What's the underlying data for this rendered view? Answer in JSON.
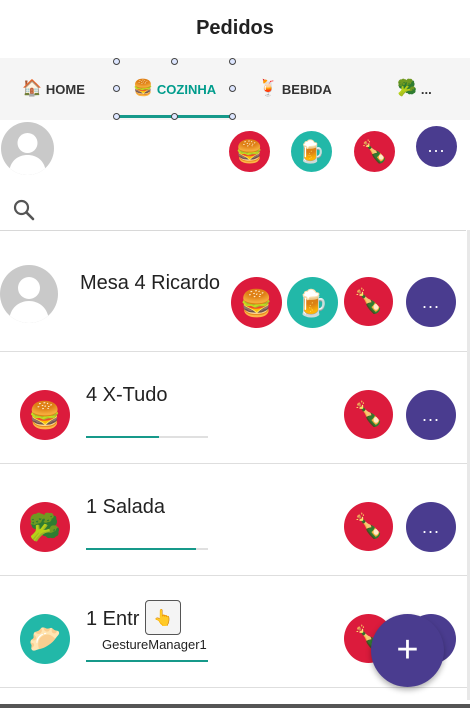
{
  "header": {
    "title": "Pedidos"
  },
  "tabs": [
    {
      "label": "HOME",
      "icon": "home-icon",
      "glyph": "🏠"
    },
    {
      "label": "COZINHA",
      "icon": "burger-icon",
      "glyph": "🍔"
    },
    {
      "label": "BEBIDA",
      "icon": "drink-icon",
      "glyph": "🍹"
    },
    {
      "label": "...",
      "icon": "broccoli-icon",
      "glyph": "🥦"
    }
  ],
  "filter_bar": {
    "more_label": "...",
    "icons": [
      "burger-icon",
      "beer-icon",
      "bottle-icon"
    ]
  },
  "search": {
    "icon": "search-icon"
  },
  "rows": [
    {
      "label": "Mesa 4 Ricardo",
      "more_label": "..."
    },
    {
      "label": "4 X-Tudo",
      "more_label": "...",
      "progress": 0.6
    },
    {
      "label": "1 Salada",
      "more_label": "...",
      "progress": 0.9
    },
    {
      "label": "1 Entr",
      "progress": 1.0
    }
  ],
  "gesture": {
    "label": "GestureManager1"
  },
  "fab": {
    "label": "+"
  },
  "colors": {
    "accent": "#16998a",
    "red": "#dc1b3c",
    "teal": "#22b8a8",
    "purple": "#4a3c8f"
  }
}
